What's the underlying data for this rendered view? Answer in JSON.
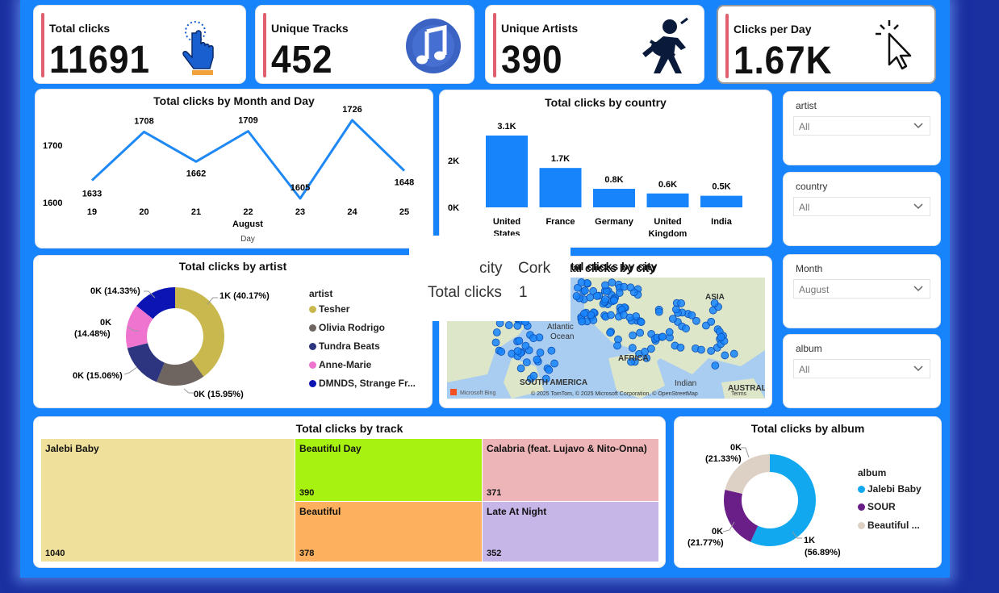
{
  "kpis": [
    {
      "label": "Total clicks",
      "value": "11691",
      "icon": "hand-click-icon"
    },
    {
      "label": "Unique Tracks",
      "value": "452",
      "icon": "music-note-icon"
    },
    {
      "label": "Unique Artists",
      "value": "390",
      "icon": "singer-icon"
    },
    {
      "label": "Clicks per Day",
      "value": "1.67K",
      "icon": "cursor-click-icon"
    }
  ],
  "line_chart": {
    "title": "Total clicks by Month and Day",
    "y_ticks": [
      "1700",
      "1600"
    ],
    "x_ticks": [
      "19",
      "20",
      "21",
      "22",
      "23",
      "24",
      "25"
    ],
    "x_group": "August",
    "xlabel": "Day"
  },
  "country_chart": {
    "title": "Total clicks by country",
    "y_ticks": [
      "2K",
      "0K"
    ],
    "categories": [
      "United States",
      "France",
      "Germany",
      "United Kingdom",
      "India"
    ],
    "labels": [
      "3.1K",
      "1.7K",
      "0.8K",
      "0.6K",
      "0.5K"
    ]
  },
  "artist_chart": {
    "title": "Total clicks by artist",
    "legend_title": "artist",
    "labels": [
      "1K (40.17%)",
      "0K (15.95%)",
      "0K (15.06%)",
      "0K\n(14.48%)",
      "0K (14.33%)"
    ]
  },
  "city_map": {
    "title": "Total clicks by city",
    "labels": [
      "ASIA",
      "Atlantic Ocean",
      "AFRICA",
      "SOUTH AMERICA",
      "Indian Ocean",
      "AUSTRAL"
    ],
    "attribution": "© 2025 TomTom, © 2025 Microsoft Corporation, © OpenStreetMap",
    "terms": "Terms",
    "brand": "Microsoft Bing"
  },
  "tooltip": {
    "k1": "city",
    "v1": "Cork",
    "k2": "Total clicks",
    "v2": "1"
  },
  "slicers": [
    {
      "label": "artist",
      "value": "All"
    },
    {
      "label": "country",
      "value": "All"
    },
    {
      "label": "Month",
      "value": "August"
    },
    {
      "label": "album",
      "value": "All"
    }
  ],
  "track_chart": {
    "title": "Total clicks by track",
    "tiles": [
      {
        "name": "Jalebi Baby",
        "value": "1040",
        "color": "#efe19c"
      },
      {
        "name": "Beautiful Day",
        "value": "390",
        "color": "#a8f212"
      },
      {
        "name": "Calabria (feat. Lujavo & Nito-Onna)",
        "value": "371",
        "color": "#eeb5b8"
      },
      {
        "name": "Beautiful",
        "value": "378",
        "color": "#fdb05e"
      },
      {
        "name": "Late At Night",
        "value": "352",
        "color": "#c6b5e7"
      }
    ]
  },
  "album_chart": {
    "title": "Total clicks by album",
    "legend_title": "album",
    "labels": [
      "1K\n(56.89%)",
      "0K\n(21.77%)",
      "0K\n(21.33%)"
    ]
  },
  "chart_data": [
    {
      "type": "line",
      "title": "Total clicks by Month and Day",
      "xlabel": "Day",
      "x": [
        19,
        20,
        21,
        22,
        23,
        24,
        25
      ],
      "series": [
        {
          "values": [
            1633,
            1708,
            1662,
            1709,
            1605,
            1726,
            1648
          ]
        }
      ],
      "color": "#1e88f5"
    },
    {
      "type": "bar",
      "title": "Total clicks by country",
      "categories": [
        "United States",
        "France",
        "Germany",
        "United Kingdom",
        "India"
      ],
      "values": [
        3100,
        1700,
        800,
        600,
        500
      ],
      "ylim": [
        0,
        3100
      ],
      "color": "#1784fb"
    },
    {
      "type": "pie",
      "title": "Total clicks by artist",
      "categories": [
        "Tesher",
        "Olivia Rodrigo",
        "Tundra Beats",
        "Anne-Marie",
        "DMNDS, Strange Fr..."
      ],
      "values": [
        40.17,
        15.95,
        15.06,
        14.48,
        14.33
      ],
      "colors": [
        "#c8b84e",
        "#6e6560",
        "#2d3580",
        "#ef74cf",
        "#0c14b4"
      ]
    },
    {
      "type": "pie",
      "title": "Total clicks by album",
      "categories": [
        "Jalebi Baby",
        "SOUR",
        "Beautiful ..."
      ],
      "values": [
        56.89,
        21.77,
        21.33
      ],
      "colors": [
        "#12a8f0",
        "#6a1e88",
        "#ddd0c4"
      ]
    },
    {
      "type": "table",
      "title": "Total clicks by track",
      "categories": [
        "Jalebi Baby",
        "Beautiful Day",
        "Beautiful",
        "Calabria (feat. Lujavo & Nito-Onna)",
        "Late At Night"
      ],
      "values": [
        1040,
        390,
        378,
        371,
        352
      ]
    }
  ]
}
